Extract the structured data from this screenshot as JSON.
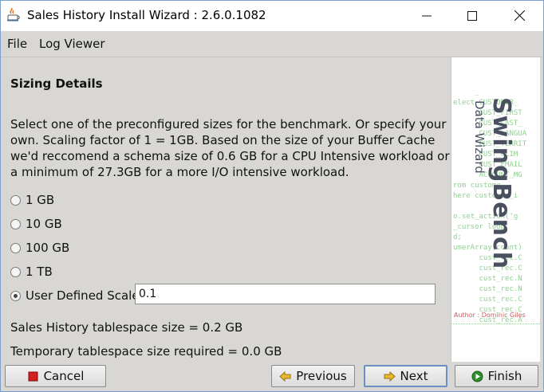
{
  "window": {
    "title": "Sales History Install Wizard : 2.6.0.1082",
    "controls": {
      "minimize_icon": "minimize-icon",
      "maximize_icon": "maximize-icon",
      "close_icon": "close-icon"
    }
  },
  "menu": {
    "items": [
      {
        "label": "File"
      },
      {
        "label": "Log Viewer"
      }
    ]
  },
  "main": {
    "heading": "Sizing Details",
    "description_lines": [
      "Select one of the preconfigured sizes for the benchmark. Or specify your",
      "own. Scaling factor of 1 = 1GB. Based on the size of your Buffer Cache",
      "we'd reccomend a schema size of 0.6 GB for a CPU Intensive workload or",
      "a minimum of 27.3GB for a more I/O intensive workload."
    ],
    "size_options": [
      {
        "label": "1 GB",
        "selected": false
      },
      {
        "label": "10 GB",
        "selected": false
      },
      {
        "label": "100 GB",
        "selected": false
      },
      {
        "label": "1 TB",
        "selected": false
      },
      {
        "label": "User Defined Scale",
        "selected": true
      }
    ],
    "user_defined_scale_value": "0.1",
    "tablespace_size": "Sales History tablespace size = 0.2 GB",
    "temp_tablespace_size": "Temporary tablespace size required = 0.0 GB"
  },
  "banner": {
    "brand": "SwingBench",
    "subtitle": "Data Wizard",
    "author": "Author : Dominic Giles",
    "code_lines": [
      "     _",
      "elect CUSTOMER_",
      "      CUST_FIRST",
      "      CUST_LAST_",
      "      CUST_LANGUA",
      "      CUST_TERRIT",
      "      CUST_CLIM",
      "      CUST_EMAIL",
      "      ACCOUNT_MG",
      "rom custome",
      "here customer_i",
      "",
      "o.set_action('g",
      "_cursor loop",
      "d;",
      "umerArray(count)",
      "      cust_rec.C",
      "      cust_rec.C",
      "      cust_rec.N",
      "      cust_rec.N",
      "      cust_rec.C",
      "      cust_rec.C",
      "      cust_rec.A"
    ]
  },
  "buttons": {
    "cancel": "Cancel",
    "previous": "Previous",
    "next": "Next",
    "finish": "Finish"
  },
  "colors": {
    "cancel_icon": "#d42020",
    "finish_icon": "#2f8f2f",
    "nav_arrow": "#e8b830",
    "code_text": "#8fd08f"
  }
}
